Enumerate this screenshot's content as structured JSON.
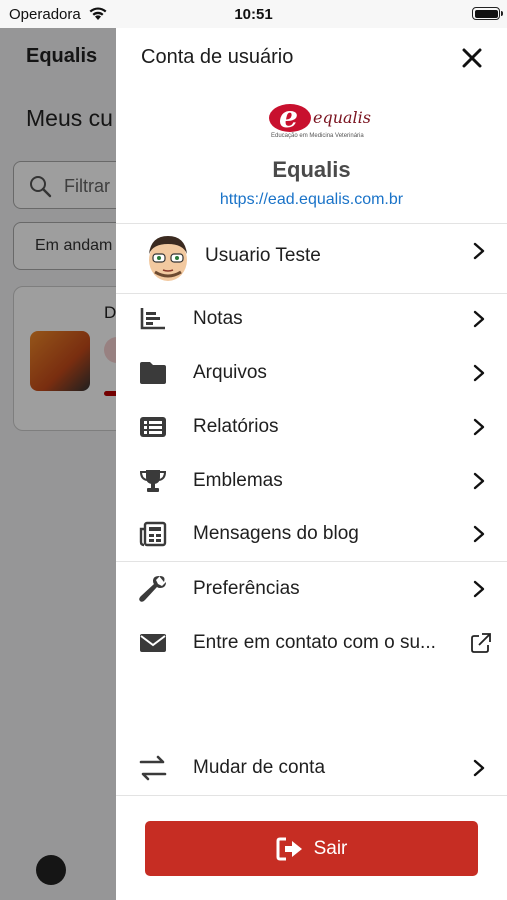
{
  "status_bar": {
    "carrier": "Operadora",
    "time": "10:51"
  },
  "background": {
    "app_title": "Equalis",
    "heading": "Meus cu",
    "search_placeholder": "Filtrar",
    "filter_value": "Em andam",
    "card_title": "D"
  },
  "drawer": {
    "title": "Conta de usuário",
    "logo": {
      "word": "equalis",
      "tagline": "Educação em Medicina Veterinária"
    },
    "site_name": "Equalis",
    "site_url": "https://ead.equalis.com.br",
    "user_name": "Usuario Teste",
    "menu": [
      {
        "label": "Notas",
        "icon": "grades-icon"
      },
      {
        "label": "Arquivos",
        "icon": "folder-icon"
      },
      {
        "label": "Relatórios",
        "icon": "list-icon"
      },
      {
        "label": "Emblemas",
        "icon": "trophy-icon"
      },
      {
        "label": "Mensagens do blog",
        "icon": "blog-icon"
      },
      {
        "label": "Preferências",
        "icon": "wrench-icon"
      },
      {
        "label": "Entre em contato com o su...",
        "icon": "envelope-icon"
      },
      {
        "label": "Mudar de conta",
        "icon": "switch-icon"
      }
    ],
    "logout_label": "Sair"
  },
  "colors": {
    "accent_red": "#c62d23",
    "link_blue": "#1a73c8",
    "icon_dark": "#3a3a3a"
  }
}
